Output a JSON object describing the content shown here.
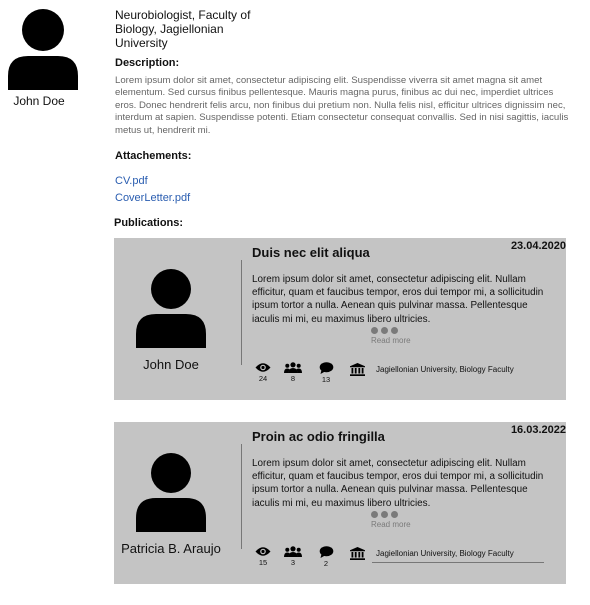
{
  "profile": {
    "name": "John Doe",
    "position_line1": "Neurobiologist, Faculty of",
    "position_line2": "Biology, Jagiellonian",
    "position_line3": "University",
    "description_title": "Description:",
    "description": "Lorem ipsum dolor sit amet, consectetur adipiscing elit. Suspendisse viverra sit amet magna sit amet elementum. Sed cursus finibus pellentesque. Mauris magna purus, finibus ac dui nec, imperdiet ultrices eros. Donec hendrerit felis arcu, non finibus dui pretium non. Nulla felis nisl, efficitur ultrices dignissim nec, interdum at sapien. Suspendisse potenti. Etiam consectetur consequat convallis. Sed in nisi sagittis, iaculis metus ut, hendrerit mi."
  },
  "attachments": {
    "title": "Attachements:",
    "files": [
      "CV.pdf",
      "CoverLetter.pdf"
    ]
  },
  "publications": {
    "title": "Publications:",
    "items": [
      {
        "author": "John Doe",
        "title": "Duis nec elit aliqua",
        "date": "23.04.2020",
        "abstract": "Lorem ipsum dolor sit amet, consectetur adipiscing elit. Nullam efficitur, quam et faucibus tempor, eros dui tempor mi, a sollicitudin ipsum tortor a nulla. Aenean quis pulvinar massa. Pellentesque iaculis mi mi, eu maximus libero ultricies.",
        "read_more": "Read more",
        "views": "24",
        "coauthors": "8",
        "comments": "13",
        "institution": "Jagiellonian University, Biology Faculty"
      },
      {
        "author": "Patricia B. Araujo",
        "title": "Proin ac odio fringilla",
        "date": "16.03.2022",
        "abstract": "Lorem ipsum dolor sit amet, consectetur adipiscing elit. Nullam efficitur, quam et faucibus tempor, eros dui tempor mi, a sollicitudin ipsum tortor a nulla. Aenean quis pulvinar massa. Pellentesque iaculis mi mi, eu maximus libero ultricies.",
        "read_more": "Read more",
        "views": "15",
        "coauthors": "3",
        "comments": "2",
        "institution": "Jagiellonian University, Biology Faculty"
      }
    ]
  },
  "icons": {
    "avatar": "user-avatar-icon",
    "views": "eye-icon",
    "coauthors": "people-icon",
    "comments": "speech-bubble-icon",
    "institution": "institution-building-icon"
  },
  "colors": {
    "card_background": "#c4c4c4",
    "link": "#2a5db0",
    "muted_text": "#666666"
  }
}
